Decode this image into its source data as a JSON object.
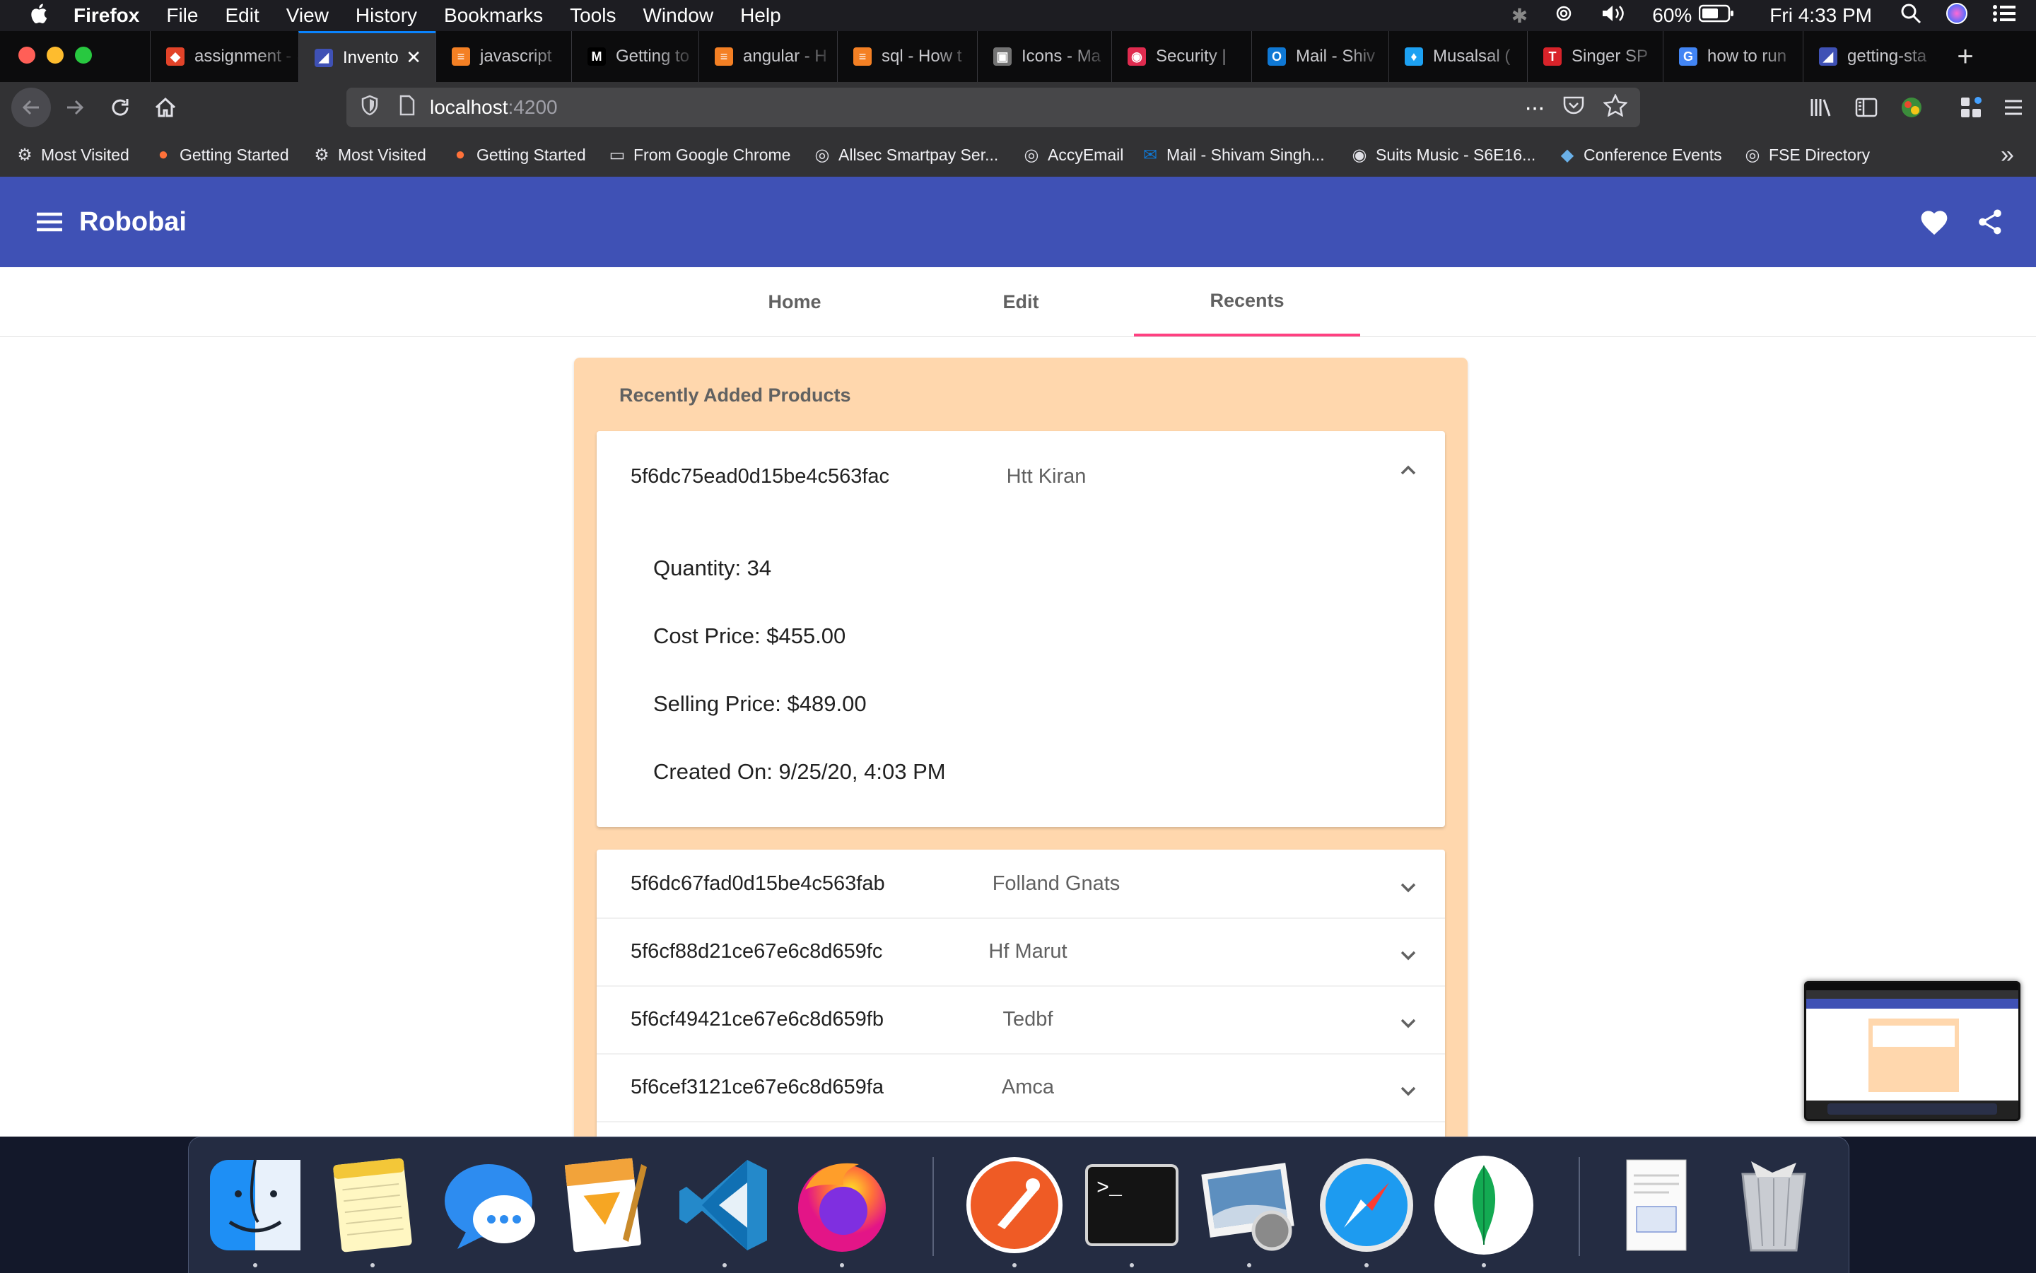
{
  "menubar": {
    "app": "Firefox",
    "items": [
      "File",
      "Edit",
      "View",
      "History",
      "Bookmarks",
      "Tools",
      "Window",
      "Help"
    ],
    "battery": "60%",
    "clock": "Fri 4:33 PM"
  },
  "tabs": [
    {
      "title": "assignment - a",
      "icon": "gitlab-icon",
      "color": "#e24329"
    },
    {
      "title": "Invento",
      "icon": "angular-icon",
      "color": "#3f51b5",
      "active": true
    },
    {
      "title": "javascript",
      "icon": "stackoverflow-icon",
      "color": "#f48024"
    },
    {
      "title": "Getting to",
      "icon": "medium-icon",
      "color": "#000000"
    },
    {
      "title": "angular - H",
      "icon": "stackoverflow-icon",
      "color": "#f48024"
    },
    {
      "title": "sql - How t",
      "icon": "stackoverflow-icon",
      "color": "#f48024"
    },
    {
      "title": "Icons - Ma",
      "icon": "material-icon",
      "color": "#737373"
    },
    {
      "title": "Security |",
      "icon": "security-icon",
      "color": "#e02b4f"
    },
    {
      "title": "Mail - Shiv",
      "icon": "outlook-icon",
      "color": "#0f78d4"
    },
    {
      "title": "Musalsal (",
      "icon": "twitter-icon",
      "color": "#1da1f2"
    },
    {
      "title": "Singer SP",
      "icon": "tnie-icon",
      "color": "#d8232a"
    },
    {
      "title": "how to run",
      "icon": "google-icon",
      "color": "#4285f4"
    },
    {
      "title": "getting-sta",
      "icon": "angular-icon",
      "color": "#3f51b5"
    }
  ],
  "url": {
    "host": "localhost",
    "port": ":4200"
  },
  "bookmarks": [
    {
      "label": "Most Visited",
      "icon": "gear-icon"
    },
    {
      "label": "Getting Started",
      "icon": "firefox-icon"
    },
    {
      "label": "Most Visited",
      "icon": "gear-icon"
    },
    {
      "label": "Getting Started",
      "icon": "firefox-icon"
    },
    {
      "label": "From Google Chrome",
      "icon": "folder-icon"
    },
    {
      "label": "Allsec Smartpay Ser...",
      "icon": "globe-icon"
    },
    {
      "label": "AccyEmail",
      "icon": "globe-icon"
    },
    {
      "label": "Mail - Shivam Singh...",
      "icon": "outlook-icon"
    },
    {
      "label": "Suits Music - S6E16...",
      "icon": "music-icon"
    },
    {
      "label": "Conference Events",
      "icon": "diamond-icon"
    },
    {
      "label": "FSE Directory",
      "icon": "globe-icon"
    }
  ],
  "app": {
    "title": "Robobai",
    "nav": [
      "Home",
      "Edit",
      "Recents"
    ],
    "active_nav": "Recents",
    "card_title": "Recently Added Products",
    "expanded": {
      "id": "5f6dc75ead0d15be4c563fac",
      "name": "Htt Kiran",
      "quantity": "Quantity: 34",
      "cost": "Cost Price: $455.00",
      "selling": "Selling Price: $489.00",
      "created": "Created On: 9/25/20, 4:03 PM"
    },
    "products": [
      {
        "id": "5f6dc67fad0d15be4c563fab",
        "name": "Folland Gnats"
      },
      {
        "id": "5f6cf88d21ce67e6c8d659fc",
        "name": "Hf Marut"
      },
      {
        "id": "5f6cf49421ce67e6c8d659fb",
        "name": "Tedbf"
      },
      {
        "id": "5f6cef3121ce67e6c8d659fa",
        "name": "Amca"
      }
    ]
  },
  "colors": {
    "toolbar": "#3f51b5",
    "card": "#ffd7ad",
    "ink_bar": "#ff4081"
  },
  "dock": [
    "finder-icon",
    "notes-icon",
    "messages-icon",
    "pages-icon",
    "vscode-icon",
    "firefox-icon",
    "postman-icon",
    "terminal-icon",
    "preview-icon",
    "safari-icon",
    "mongodb-compass-icon",
    "document-icon",
    "trash-icon"
  ]
}
